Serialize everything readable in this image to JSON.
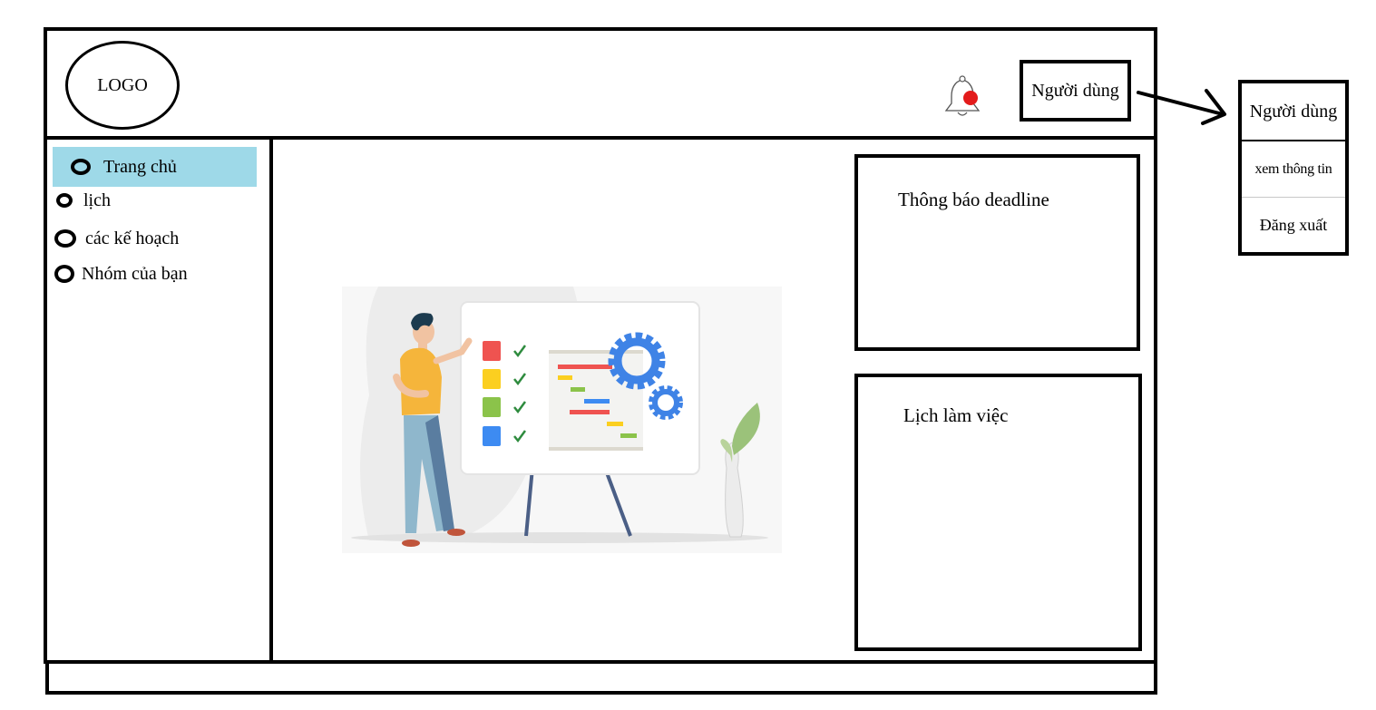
{
  "header": {
    "logo_text": "LOGO",
    "user_button_label": "Người dùng",
    "bell_icon": "bell-icon",
    "notification_color": "#e31b1b"
  },
  "user_menu": {
    "title": "Người dùng",
    "items": [
      {
        "label": "xem thông tin"
      },
      {
        "label": "Đăng xuất"
      }
    ]
  },
  "sidebar": {
    "active_color": "#9ed9e8",
    "items": [
      {
        "label": "Trang chủ",
        "active": true
      },
      {
        "label": "lịch"
      },
      {
        "label": "các kế hoạch"
      },
      {
        "label": "Nhóm của bạn"
      }
    ]
  },
  "main": {
    "illustration": "project-planning-illustration",
    "panels": {
      "deadline_title": "Thông báo deadline",
      "schedule_title": "Lịch làm việc"
    }
  }
}
